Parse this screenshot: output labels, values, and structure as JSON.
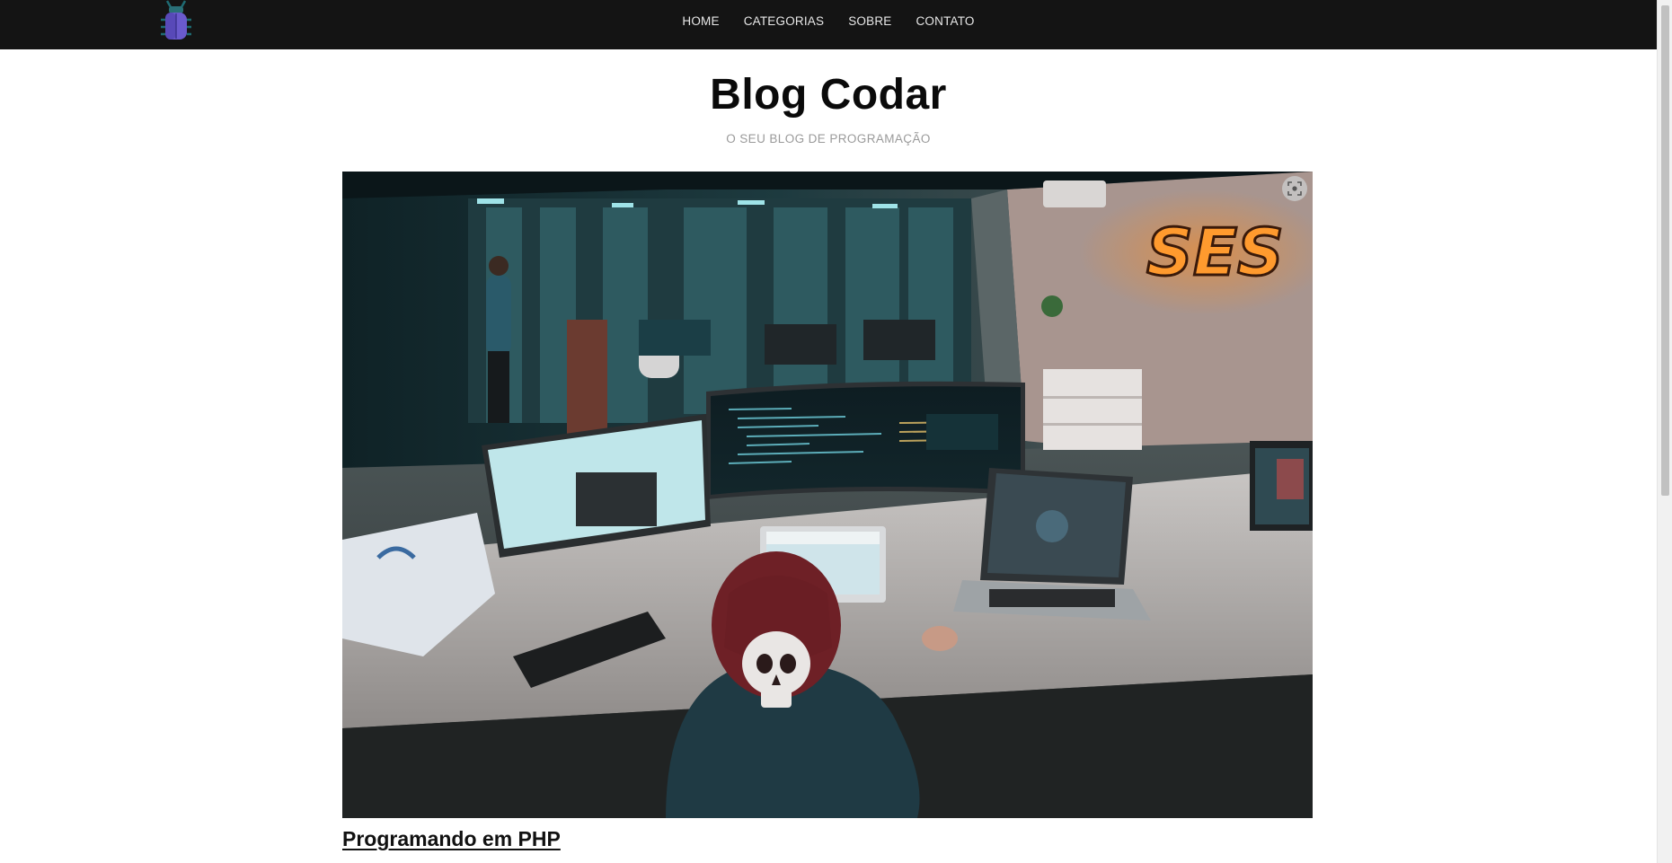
{
  "nav": {
    "logo": "bug-logo",
    "items": [
      {
        "label": "HOME"
      },
      {
        "label": "CATEGORIAS"
      },
      {
        "label": "SOBRE"
      },
      {
        "label": "CONTATO"
      }
    ]
  },
  "header": {
    "title": "Blog Codar",
    "subtitle": "O SEU BLOG DE PROGRAMAÇÃO"
  },
  "hero": {
    "image": "office-programmer-photo",
    "sign_text": "SES",
    "lens_icon": "lens-search-icon"
  },
  "post": {
    "title": "Programando em PHP"
  },
  "colors": {
    "navbar": "#141414",
    "nav_text": "#e9e9e9",
    "title": "#0a0a0a",
    "subtitle": "#9a9a9a",
    "logo": "#6a5acd"
  }
}
